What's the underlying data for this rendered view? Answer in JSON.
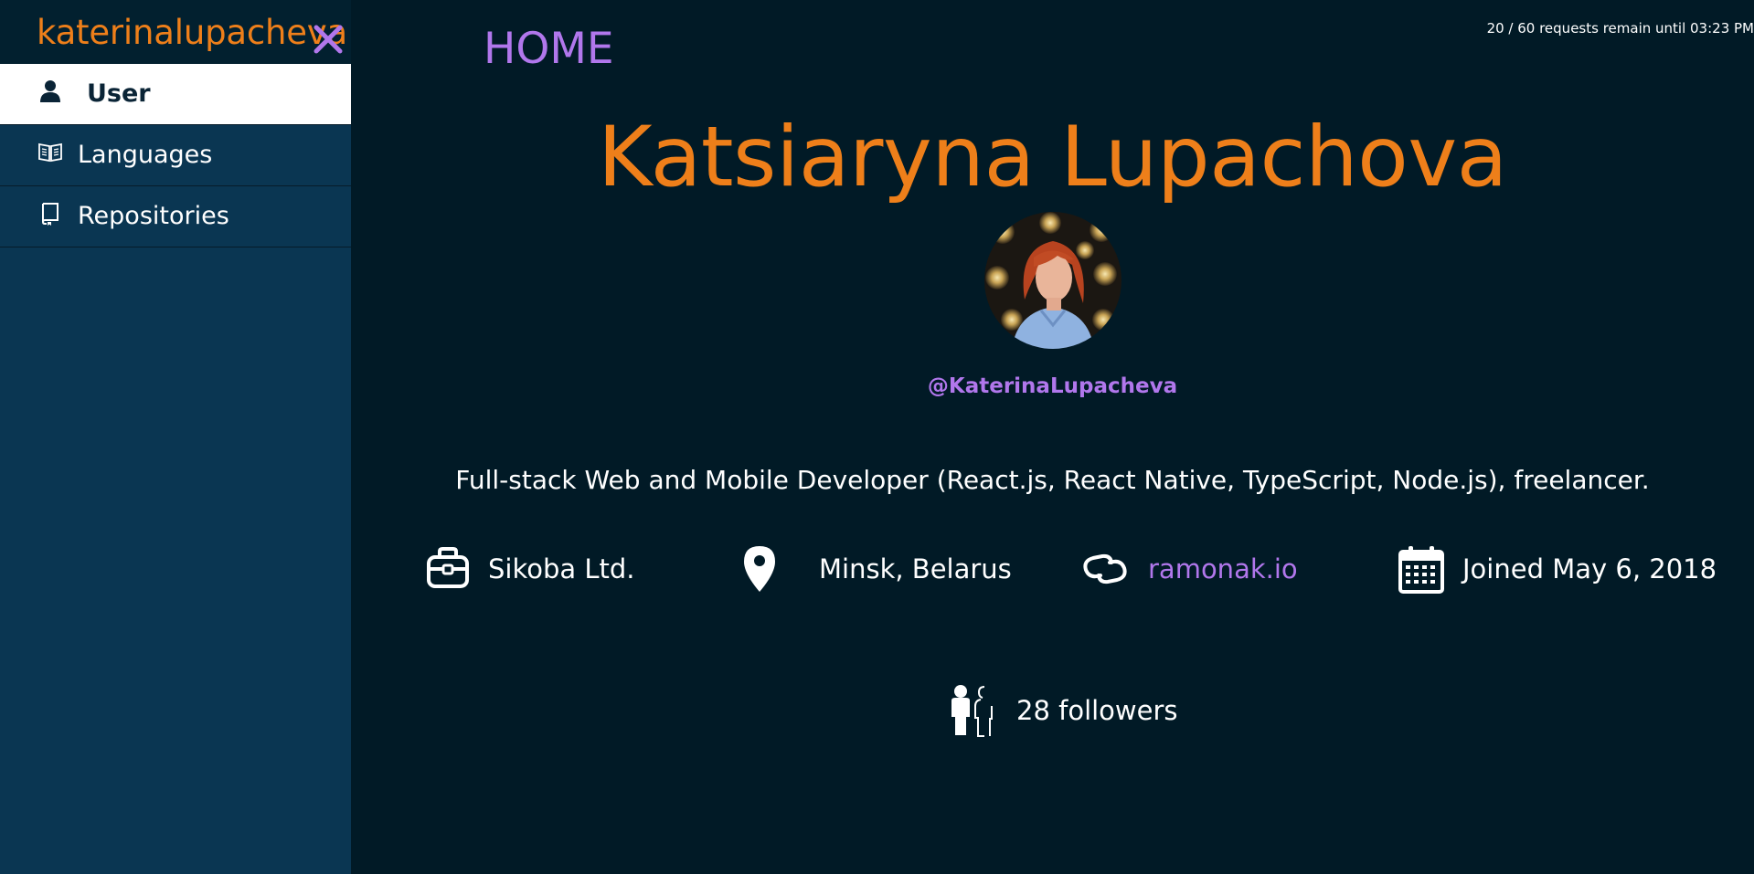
{
  "sidebar": {
    "brand": "katerinalupacheva",
    "close_icon": "close-icon",
    "accent_color": "#ee7f1a",
    "background_color": "#0a3652",
    "items": [
      {
        "label": "User",
        "icon": "user-icon",
        "active": true
      },
      {
        "label": "Languages",
        "icon": "book-open-icon",
        "active": false
      },
      {
        "label": "Repositories",
        "icon": "book-icon",
        "active": false
      }
    ]
  },
  "header": {
    "home_label": "HOME",
    "rate_limit": "20 / 60 requests remain until 03:23 PM"
  },
  "profile": {
    "name": "Katsiaryna Lupachova",
    "avatar": "avatar-photo",
    "username": "@KaterinaLupacheva",
    "bio": "Full-stack Web and Mobile Developer (React.js, React Native, TypeScript, Node.js), freelancer.",
    "info": [
      {
        "icon": "briefcase-icon",
        "text": "Sikoba Ltd."
      },
      {
        "icon": "location-pin-icon",
        "text": "Minsk, Belarus"
      },
      {
        "icon": "link-icon",
        "text": "ramonak.io"
      },
      {
        "icon": "calendar-icon",
        "text": "Joined May 6, 2018"
      }
    ],
    "followers": {
      "icon": "followers-icon",
      "text": "28 followers"
    }
  },
  "colors": {
    "name": "#ee7f1a",
    "link": "#b177ec",
    "background": "#011a26"
  }
}
